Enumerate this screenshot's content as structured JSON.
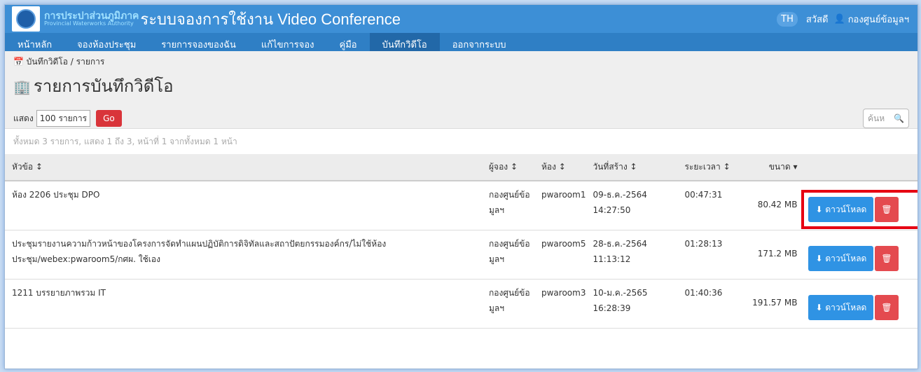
{
  "brand": {
    "logo_th": "การประปาส่วนภูมิภาค",
    "logo_en": "Provincial Waterworks Authority",
    "app_title": "ระบบจองการใช้งาน Video Conference"
  },
  "user": {
    "lang": "TH",
    "greeting": "สวัสดี",
    "user_icon": "user-icon",
    "name": "กองศูนย์ข้อมูลฯ"
  },
  "nav": [
    "หน้าหลัก",
    "จองห้องประชุม",
    "รายการจองของฉัน",
    "แก้ไขการจอง",
    "คู่มือ",
    "บันทึกวิดีโอ",
    "ออกจากระบบ"
  ],
  "nav_active": "บันทึกวิดีโอ",
  "breadcrumb": {
    "icon": "calendar-icon",
    "text": "บันทึกวิดีโอ / รายการ"
  },
  "page_title": {
    "icon": "building-icon",
    "text": "รายการบันทึกวิดีโอ"
  },
  "controls": {
    "show_label": "แสดง",
    "per_page": "100 รายการ",
    "go": "Go",
    "search_placeholder": "ค้นห",
    "search_icon": "search-icon"
  },
  "summary": "ทั้งหมด 3 รายการ, แสดง 1 ถึง 3, หน้าที่ 1 จากทั้งหมด 1 หน้า",
  "columns": [
    "หัวข้อ ↕",
    "ผู้จอง ↕",
    "ห้อง ↕",
    "วันที่สร้าง ↕",
    "ระยะเวลา ↕",
    "ขนาด ▾"
  ],
  "download_label": "ดาวน์โหลด",
  "rows": [
    {
      "title": "ห้อง 2206 ประชุม DPO",
      "owner": "กองศูนย์ข้อมูลฯ",
      "room": "pwaroom1",
      "date": "09-ธ.ค.-2564",
      "time": "14:27:50",
      "duration": "00:47:31",
      "size": "80.42 MB"
    },
    {
      "title": "ประชุมรายงานความก้าวหน้าของโครงการจัดทำแผนปฏิบัติการดิจิทัลและสถาปัตยกรรมองค์กร/ไม่ใช้ห้องประชุม/webex:pwaroom5/กศผ. ใช้เอง",
      "owner": "กองศูนย์ข้อมูลฯ",
      "room": "pwaroom5",
      "date": "28-ธ.ค.-2564",
      "time": "11:13:12",
      "duration": "01:28:13",
      "size": "171.2 MB"
    },
    {
      "title": "1211 บรรยายภาพรวม IT",
      "owner": "กองศูนย์ข้อมูลฯ",
      "room": "pwaroom3",
      "date": "10-ม.ค.-2565",
      "time": "16:28:39",
      "duration": "01:40:36",
      "size": "191.57 MB"
    }
  ]
}
